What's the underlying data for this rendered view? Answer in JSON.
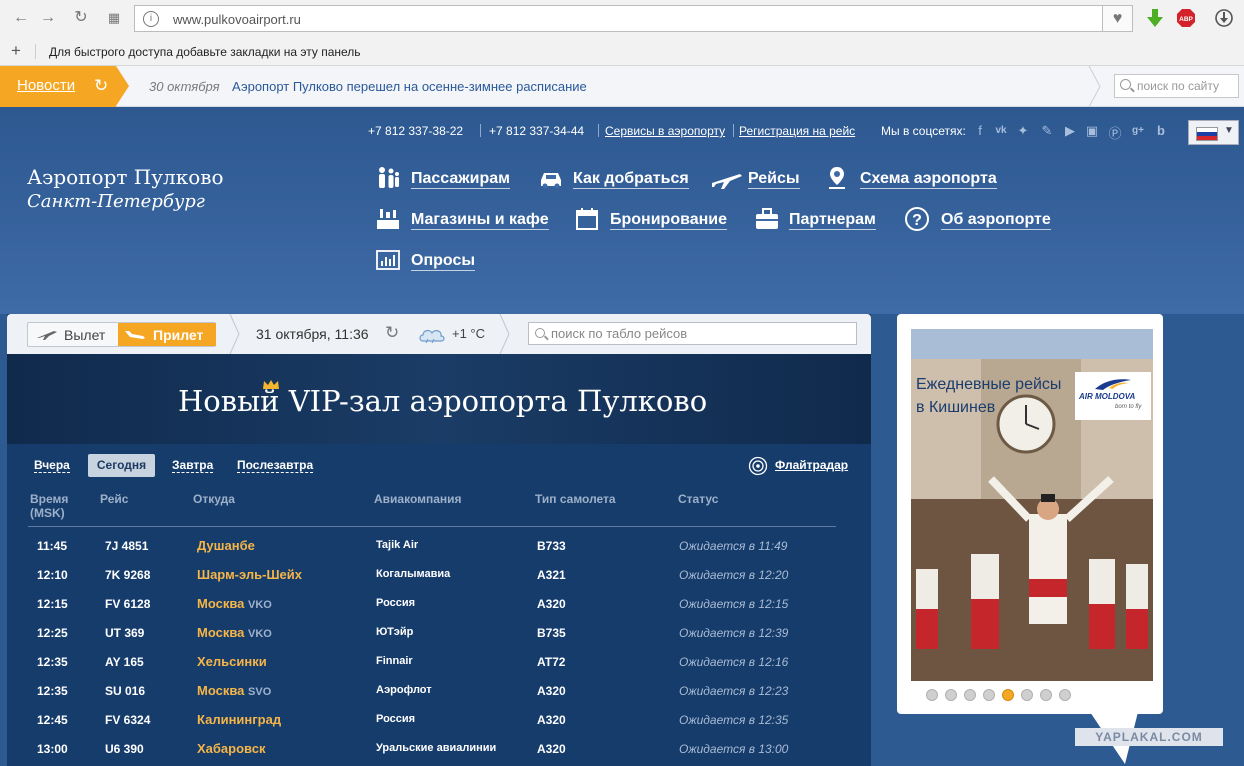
{
  "browser": {
    "url": "www.pulkovoairport.ru",
    "bookmarks_hint": "Для быстрого доступа добавьте закладки на эту панель",
    "extension_abp": "ABP"
  },
  "newsbar": {
    "label": "Новости",
    "date": "30 октября",
    "headline": "Аэропорт Пулково перешел на осенне-зимнее расписание",
    "search_placeholder": "поиск по сайту"
  },
  "header": {
    "phone1": "+7 812 337-38-22",
    "phone2": "+7 812 337-34-44",
    "link_services": "Сервисы в аэропорту",
    "link_registration": "Регистрация на рейс",
    "social_label": "Мы в соцсетях:",
    "social_icons": [
      "facebook-icon",
      "vk-icon",
      "twitter-icon",
      "lj-icon",
      "youtube-icon",
      "instagram-icon",
      "pinterest-icon",
      "googleplus-icon",
      "blogger-icon"
    ],
    "logo_line1": "Аэропорт Пулково",
    "logo_line2": "Санкт-Петербург",
    "menu": [
      {
        "label": "Пассажирам",
        "icon": "passengers-icon"
      },
      {
        "label": "Как добраться",
        "icon": "car-icon"
      },
      {
        "label": "Рейсы",
        "icon": "plane-icon"
      },
      {
        "label": "Схема аэропорта",
        "icon": "map-pin-icon"
      },
      {
        "label": "Магазины и кафе",
        "icon": "shop-icon"
      },
      {
        "label": "Бронирование",
        "icon": "calendar-icon"
      },
      {
        "label": "Партнерам",
        "icon": "briefcase-icon"
      },
      {
        "label": "Об аэропорте",
        "icon": "question-icon"
      },
      {
        "label": "Опросы",
        "icon": "poll-chart-icon"
      }
    ]
  },
  "board": {
    "departure_label": "Вылет",
    "arrival_label": "Прилет",
    "datetime": "31 октября, 11:36",
    "temperature": "+1 °C",
    "search_placeholder": "поиск по табло рейсов",
    "banner_title": "Новый VIP-зал аэропорта Пулково",
    "day_tabs": [
      "Вчера",
      "Сегодня",
      "Завтра",
      "Послезавтра"
    ],
    "active_day": "Сегодня",
    "flightradar_label": "Флайтрадар",
    "columns": {
      "time": "Время (MSK)",
      "flight": "Рейс",
      "from": "Откуда",
      "airline": "Авиакомпания",
      "aircraft": "Тип самолета",
      "status": "Статус"
    },
    "flights": [
      {
        "time": "11:45",
        "flight": "7J 4851",
        "city": "Душанбе",
        "terminal": "",
        "airline": "Tajik Air",
        "aircraft": "B733",
        "status": "Ожидается в 11:49"
      },
      {
        "time": "12:10",
        "flight": "7K 9268",
        "city": "Шарм-эль-Шейх",
        "terminal": "",
        "airline": "Когалымавиа",
        "aircraft": "A321",
        "status": "Ожидается в 12:20"
      },
      {
        "time": "12:15",
        "flight": "FV 6128",
        "city": "Москва",
        "terminal": "VKO",
        "airline": "Россия",
        "aircraft": "A320",
        "status": "Ожидается в 12:15"
      },
      {
        "time": "12:25",
        "flight": "UT 369",
        "city": "Москва",
        "terminal": "VKO",
        "airline": "ЮТэйр",
        "aircraft": "B735",
        "status": "Ожидается в 12:39"
      },
      {
        "time": "12:35",
        "flight": "AY 165",
        "city": "Хельсинки",
        "terminal": "",
        "airline": "Finnair",
        "aircraft": "AT72",
        "status": "Ожидается в 12:16"
      },
      {
        "time": "12:35",
        "flight": "SU 016",
        "city": "Москва",
        "terminal": "SVO",
        "airline": "Аэрофлот",
        "aircraft": "A320",
        "status": "Ожидается в 12:23"
      },
      {
        "time": "12:45",
        "flight": "FV 6324",
        "city": "Калининград",
        "terminal": "",
        "airline": "Россия",
        "aircraft": "A320",
        "status": "Ожидается в 12:35"
      },
      {
        "time": "13:00",
        "flight": "U6 390",
        "city": "Хабаровск",
        "terminal": "",
        "airline": "Уральские авиалинии",
        "aircraft": "A320",
        "status": "Ожидается в 13:00"
      }
    ]
  },
  "ad": {
    "caption_line1": "Ежедневные рейсы",
    "caption_line2": "в Кишинев",
    "brand": "AIR MOLDOVA",
    "slogan": "born to fly",
    "slide_count": 8,
    "active_slide": 5
  },
  "watermark": "YAPLAKAL.COM",
  "colors": {
    "accent_orange": "#f5a623",
    "header_blue": "#2d5890",
    "board_blue": "#163c6c",
    "city_gold": "#f5b547"
  }
}
